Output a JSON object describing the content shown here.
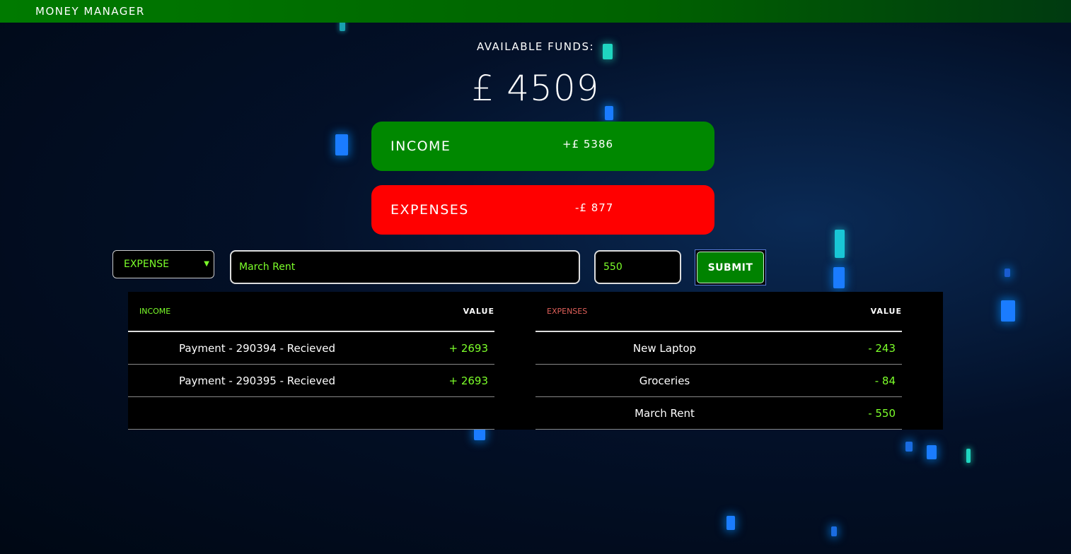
{
  "app": {
    "title": "MONEY MANAGER"
  },
  "funds": {
    "label": "AVAILABLE FUNDS:",
    "value": "£ 4509"
  },
  "summary": {
    "income": {
      "label": "INCOME",
      "value": "+£ 5386",
      "color": "#008800"
    },
    "expenses": {
      "label": "EXPENSES",
      "value": "-£ 877",
      "color": "#ff0000"
    }
  },
  "form": {
    "type_selected": "EXPENSE",
    "description_value": "March Rent",
    "amount_value": "550",
    "submit_label": "SUBMIT"
  },
  "income_table": {
    "header": "INCOME",
    "value_header": "VALUE",
    "rows": [
      {
        "name": "Payment - 290394 - Recieved",
        "amount": "+ 2693"
      },
      {
        "name": "Payment - 290395 - Recieved",
        "amount": "+ 2693"
      }
    ]
  },
  "expense_table": {
    "header": "EXPENSES",
    "value_header": "VALUE",
    "rows": [
      {
        "name": "New Laptop",
        "amount": "- 243"
      },
      {
        "name": "Groceries",
        "amount": "- 84"
      },
      {
        "name": "March Rent",
        "amount": "- 550"
      }
    ]
  },
  "colors": {
    "accent_green": "#7cff2a",
    "topbar_green": "#007a00",
    "expense_header_red": "#e0605a"
  }
}
